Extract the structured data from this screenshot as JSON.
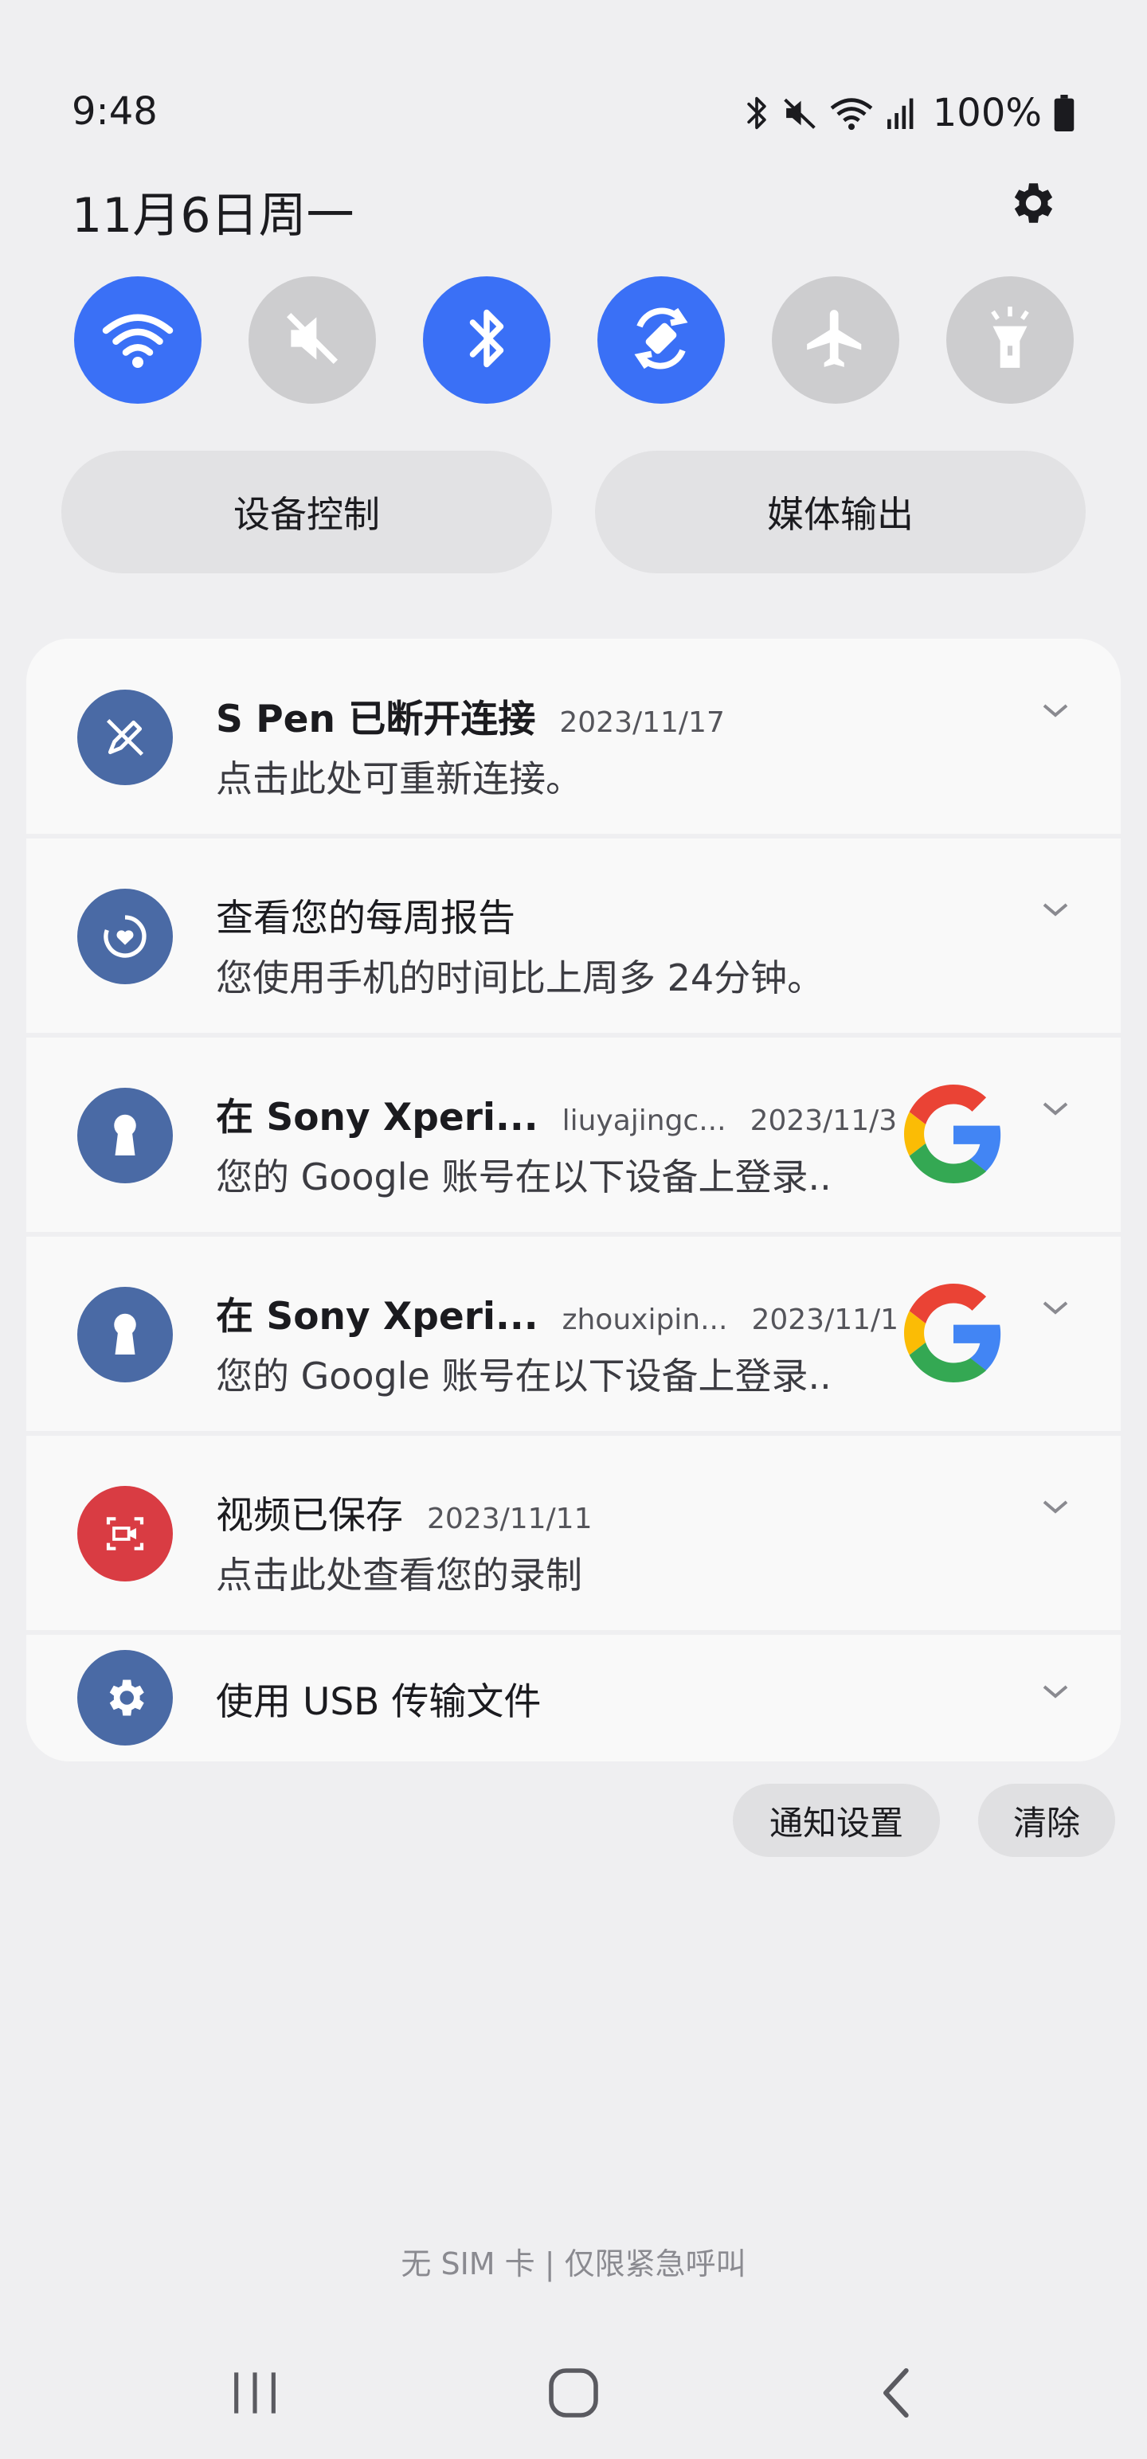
{
  "status_bar": {
    "time": "9:48",
    "battery": "100%",
    "icons": [
      "bluetooth-icon",
      "mute-icon",
      "wifi-icon",
      "signal-icon",
      "battery-icon"
    ]
  },
  "header": {
    "date": "11月6日周一",
    "settings_icon": "gear-icon"
  },
  "quick_toggles": [
    {
      "name": "wifi",
      "icon": "wifi-icon",
      "state": "on"
    },
    {
      "name": "sound",
      "icon": "mute-icon",
      "state": "off"
    },
    {
      "name": "bluetooth",
      "icon": "bluetooth-icon",
      "state": "on"
    },
    {
      "name": "auto-rotate",
      "icon": "rotate-icon",
      "state": "on"
    },
    {
      "name": "airplane",
      "icon": "airplane-icon",
      "state": "off"
    },
    {
      "name": "flashlight",
      "icon": "flashlight-icon",
      "state": "off"
    }
  ],
  "pills": {
    "device_control": "设备控制",
    "media_output": "媒体输出"
  },
  "notifications": [
    {
      "title": "S Pen 已断开连接",
      "account": "",
      "date": "2023/11/17",
      "body": "点击此处可重新连接。",
      "icon": "pen-icon",
      "icon_color": "#4a6aa5"
    },
    {
      "title": "查看您的每周报告",
      "account": "",
      "date": "",
      "body": "您使用手机的时间比上周多 24分钟。",
      "icon": "wellbeing-icon",
      "icon_color": "#4a6aa5"
    },
    {
      "title": "在 Sony Xperi...",
      "account": "liuyajingc...",
      "date": "2023/11/3",
      "body": "您的 Google 账号在以下设备上登录..",
      "icon": "keyhole-icon",
      "icon_color": "#4a6aa5"
    },
    {
      "title": "在 Sony Xperi...",
      "account": "zhouxipin...",
      "date": "2023/11/1",
      "body": "您的 Google 账号在以下设备上登录..",
      "icon": "keyhole-icon",
      "icon_color": "#4a6aa5"
    },
    {
      "title": "视频已保存",
      "account": "",
      "date": "2023/11/11",
      "body": "点击此处查看您的录制",
      "icon": "screen-record-icon",
      "icon_color": "#d93c43"
    },
    {
      "title": "使用 USB 传输文件",
      "account": "",
      "date": "",
      "body": "",
      "icon": "usb-settings-icon",
      "icon_color": "#4a6aa5"
    }
  ],
  "footer_buttons": {
    "notification_settings": "通知设置",
    "clear": "清除"
  },
  "sim_status": "无 SIM 卡 | 仅限紧急呼叫",
  "colors": {
    "accent": "#3a70f6",
    "toggle_off": "#cdcdcf",
    "notif_icon_blue": "#4a6aa5",
    "notif_icon_red": "#d93c43"
  }
}
